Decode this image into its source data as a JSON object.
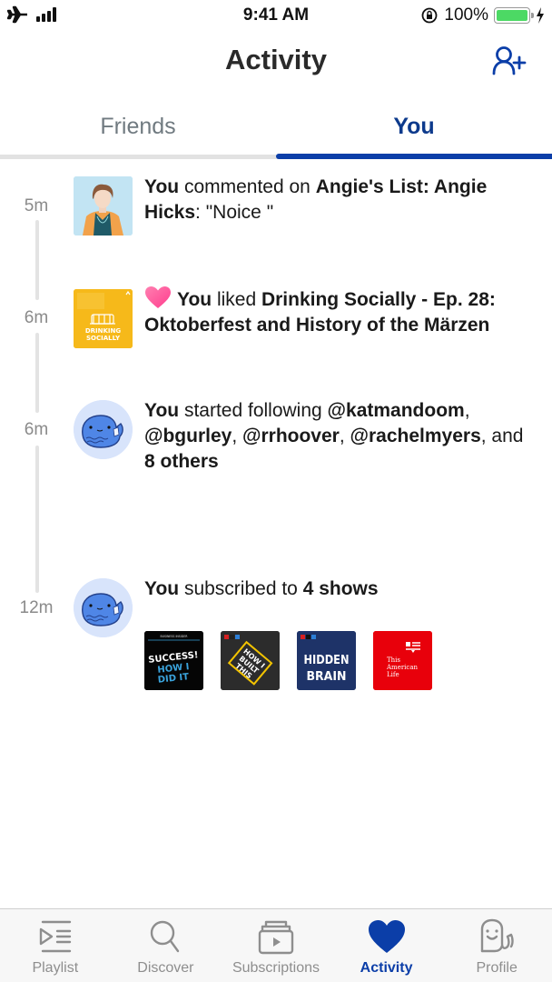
{
  "status_bar": {
    "time": "9:41 AM",
    "battery_percent": "100%",
    "battery_level": 1.0,
    "signal_bars": 4,
    "airplane_mode": true
  },
  "header": {
    "title": "Activity",
    "add_friend_icon": "person-add-icon"
  },
  "tabs": [
    {
      "label": "Friends",
      "active": false
    },
    {
      "label": "You",
      "active": true
    }
  ],
  "feed": [
    {
      "time": "5m",
      "thumbnail": "angie-hicks-avatar",
      "parts": [
        {
          "text": "You",
          "bold": true
        },
        {
          "text": " commented on ",
          "bold": false
        },
        {
          "text": "Angie's List: Angie Hicks",
          "bold": true
        },
        {
          "text": ": \"Noice \"",
          "bold": false
        }
      ]
    },
    {
      "time": "6m",
      "thumbnail": "drinking-socially-artwork",
      "thumbnail_label": "DRINKING SOCIALLY",
      "icon": "heart-icon",
      "parts": [
        {
          "text": "You",
          "bold": true
        },
        {
          "text": " liked ",
          "bold": false
        },
        {
          "text": "Drinking Socially - Ep. 28: Oktoberfest and History of the Märzen",
          "bold": true
        }
      ]
    },
    {
      "time": "6m",
      "thumbnail": "whale-avatar",
      "parts": [
        {
          "text": "You",
          "bold": true
        },
        {
          "text": " started following ",
          "bold": false
        },
        {
          "text": "@katmandoom",
          "bold": true
        },
        {
          "text": ", ",
          "bold": false
        },
        {
          "text": "@bgurley",
          "bold": true
        },
        {
          "text": ", ",
          "bold": false
        },
        {
          "text": "@rrhoover",
          "bold": true
        },
        {
          "text": ", ",
          "bold": false
        },
        {
          "text": "@rachelmyers",
          "bold": true
        },
        {
          "text": ", and ",
          "bold": false
        },
        {
          "text": "8 others",
          "bold": true
        }
      ]
    },
    {
      "time": "12m",
      "thumbnail": "whale-avatar",
      "parts": [
        {
          "text": "You",
          "bold": true
        },
        {
          "text": " subscribed to ",
          "bold": false
        },
        {
          "text": "4 shows",
          "bold": true
        }
      ],
      "shows": [
        {
          "name": "Success! How I Did It",
          "publisher": "BUSINESS INSIDER",
          "line1": "SUCCESS!",
          "line2": "HOW I",
          "line3": "DID IT",
          "color": "#000000"
        },
        {
          "name": "How I Built This",
          "publisher": "npr",
          "line1": "HOW I",
          "line2": "BUILT",
          "line3": "THIS",
          "color": "#2b2b2b"
        },
        {
          "name": "Hidden Brain",
          "publisher": "npr",
          "line1": "HIDDEN",
          "line2": "BRAIN",
          "color": "#1d3266"
        },
        {
          "name": "This American Life",
          "line1": "This",
          "line2": "American",
          "line3": "Life",
          "color": "#e8000b"
        }
      ]
    }
  ],
  "tab_bar": [
    {
      "label": "Playlist",
      "icon": "playlist-icon",
      "active": false
    },
    {
      "label": "Discover",
      "icon": "search-icon",
      "active": false
    },
    {
      "label": "Subscriptions",
      "icon": "subscriptions-icon",
      "active": false
    },
    {
      "label": "Activity",
      "icon": "heart-icon",
      "active": true
    },
    {
      "label": "Profile",
      "icon": "profile-icon",
      "active": false
    }
  ],
  "colors": {
    "accent": "#0b3ea8",
    "tab_active_text": "#0d3a8c",
    "tab_inactive_text": "#707a80",
    "heart_pink": "#ff5fa2",
    "battery_green": "#4cd964"
  }
}
